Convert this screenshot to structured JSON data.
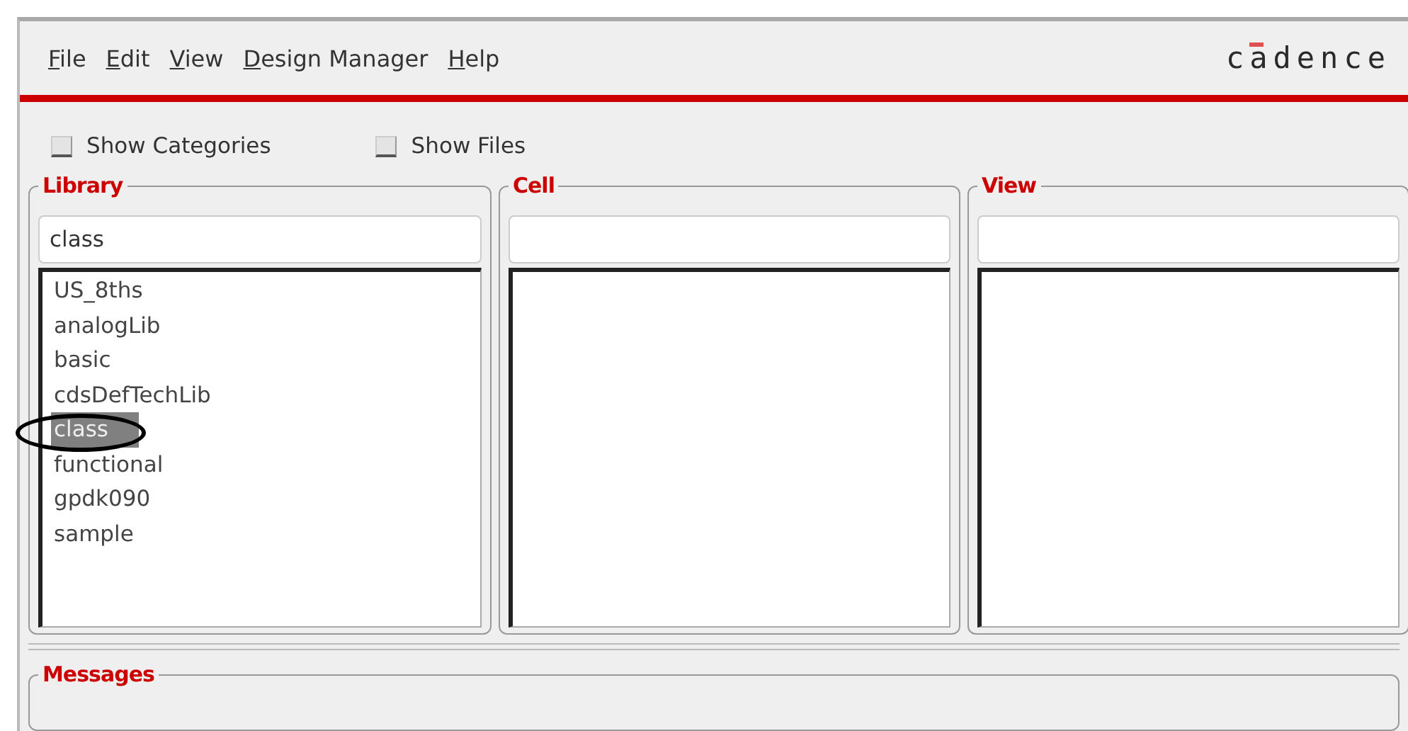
{
  "menu": [
    "File",
    "Edit",
    "View",
    "Design Manager",
    "Help"
  ],
  "logo": "cadence",
  "options": [
    {
      "label": "Show Categories",
      "checked": false
    },
    {
      "label": "Show Files",
      "checked": false
    }
  ],
  "panes": [
    {
      "title": "Library",
      "filter": "class",
      "items": [
        {
          "label": "US_8ths",
          "selected": false
        },
        {
          "label": "analogLib",
          "selected": false
        },
        {
          "label": "basic",
          "selected": false
        },
        {
          "label": "cdsDefTechLib",
          "selected": false
        },
        {
          "label": "class",
          "selected": true
        },
        {
          "label": "functional",
          "selected": false
        },
        {
          "label": "gpdk090",
          "selected": false
        },
        {
          "label": "sample",
          "selected": false
        }
      ],
      "circled": true
    },
    {
      "title": "Cell",
      "circled": false
    },
    {
      "title": "View",
      "circled": false
    }
  ],
  "messages": {
    "title": "Messages"
  }
}
